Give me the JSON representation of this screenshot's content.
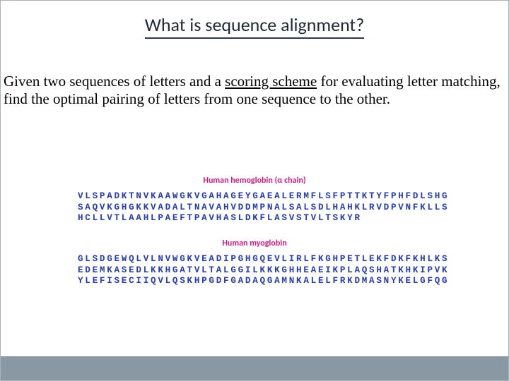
{
  "title": "What is sequence alignment?",
  "paragraph": {
    "part1": "Given two sequences of letters and a ",
    "underlined": "scoring scheme",
    "part2": " for evaluating letter matching, find the optimal pairing of letters from one sequence to the other."
  },
  "sequences": [
    {
      "label": "Human hemoglobin (α chain)",
      "lines": [
        "VLSPADKTNVKAAWGKVGAHAGEYGAEALERMFLSFPTTKTYFPHFDLSHG",
        "SAQVKGHGKKVADALTNAVAHVDDMPNALSALSDLHAHKLRVDPVNFKLLS",
        "HCLLVTLAAHLPAEFTPAVHASLDKFLASVSTVLTSKYR"
      ]
    },
    {
      "label": "Human myoglobin",
      "lines": [
        "GLSDGEWQLVLNVWGKVEADIPGHGQEVLIRLFKGHPETLEKFDKFKHLKS",
        "EDEMKASEDLKKHGATVLTALGGILKKKGHHEAEIKPLAQSHATKHKIPVK",
        "YLEFISECIIQVLQSKHPGDFGADAQGAMNKALELFRKDMASNYKELGFQG"
      ]
    }
  ]
}
